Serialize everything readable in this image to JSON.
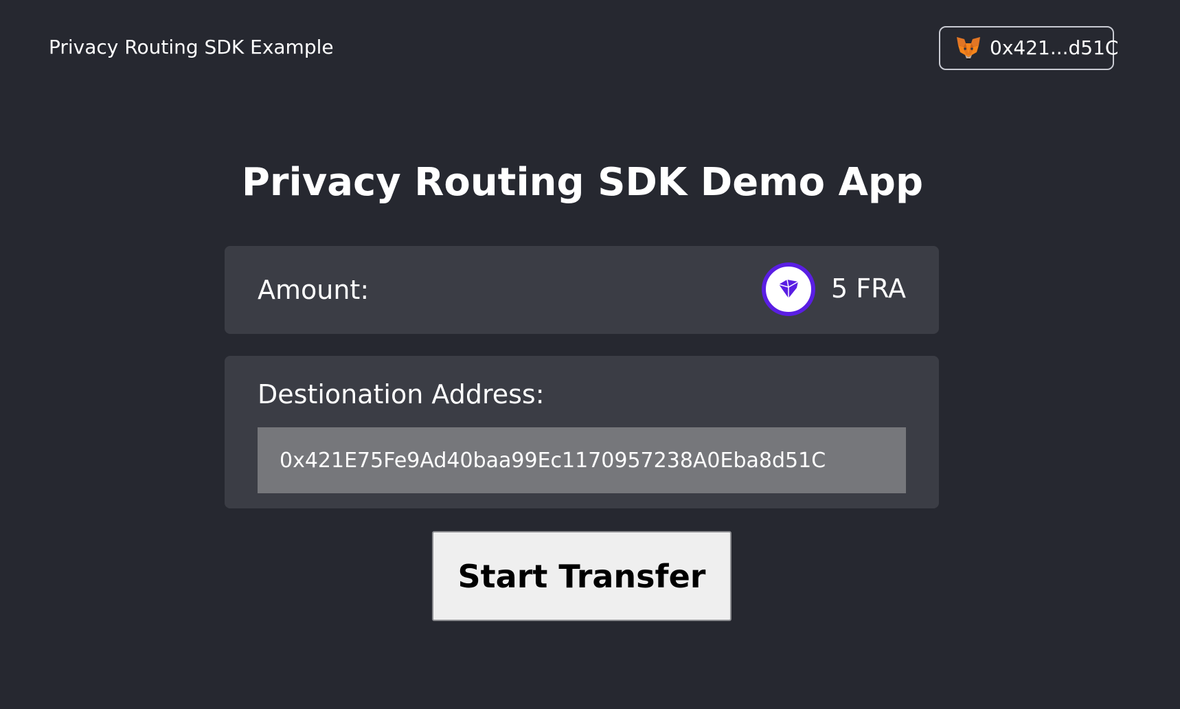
{
  "header": {
    "title": "Privacy Routing SDK Example",
    "wallet": {
      "icon": "metamask-fox-icon",
      "address": "0x421...d51C"
    }
  },
  "main": {
    "title": "Privacy Routing SDK Demo App",
    "amount": {
      "label": "Amount:",
      "token_icon": "fra-token-icon",
      "value": "5 FRA"
    },
    "destination": {
      "label": "Destionation Address:",
      "value": "0x421E75Fe9Ad40baa99Ec1170957238A0Eba8d51C"
    },
    "start_button_label": "Start Transfer"
  },
  "colors": {
    "background": "#262830",
    "card": "#3b3d45",
    "input": "#76777b",
    "token_accent": "#5a1ee3"
  }
}
